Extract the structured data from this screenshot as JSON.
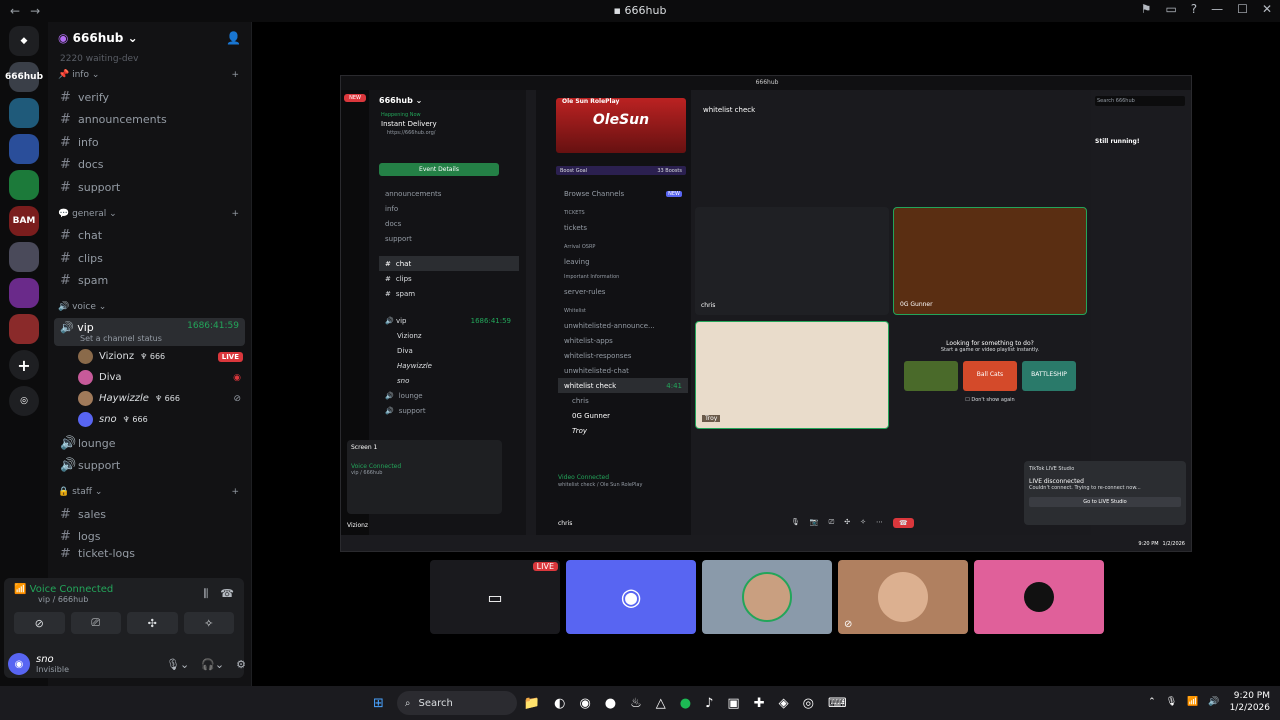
{
  "window": {
    "title": "666hub"
  },
  "rail": {
    "servers": [
      "666hub",
      "BAM",
      "Ole Sun"
    ]
  },
  "server": {
    "name": "666hub"
  },
  "sidebar": {
    "truncated": "2220 waiting-dev",
    "categories": [
      {
        "name": "info",
        "channels": [
          "verify",
          "announcements",
          "info",
          "docs",
          "support"
        ]
      },
      {
        "name": "general",
        "channels": [
          "chat",
          "clips",
          "spam"
        ]
      },
      {
        "name": "voice"
      }
    ],
    "vip": {
      "name": "vip",
      "timer": "1686:41:59",
      "status": "Set a channel status"
    },
    "voice_users": [
      {
        "name": "Vizionz",
        "tag": "666",
        "live": "LIVE"
      },
      {
        "name": "Diva"
      },
      {
        "name": "Haywizzle",
        "tag": "666"
      },
      {
        "name": "sno",
        "tag": "666"
      }
    ],
    "voice_channels": [
      "lounge",
      "support"
    ],
    "staff": {
      "name": "staff",
      "channels": [
        "sales",
        "logs",
        "ticket-logs"
      ]
    }
  },
  "voice_panel": {
    "title": "Voice Connected",
    "sub": "vip / 666hub"
  },
  "user": {
    "name": "sno",
    "status": "Invisible"
  },
  "stream": {
    "inner_title": "Ole Sun RolePlay",
    "hub_name": "666hub",
    "event": {
      "tag": "Happening Now",
      "name": "Instant Delivery",
      "url": "https://666hub.org/",
      "button": "Event Details"
    },
    "inner_channels": [
      "announcements",
      "info",
      "docs",
      "support"
    ],
    "chat": "chat",
    "clips": "clips",
    "spam": "spam",
    "vip": "vip",
    "vip_timer": "1686:41:59",
    "lounge": "lounge",
    "support2": "support",
    "inner_users": [
      "Vizionz",
      "Diva",
      "Haywizzle",
      "sno"
    ],
    "screen": "Screen 1",
    "inner_vc": "Voice Connected",
    "inner_vc_sub": "vip / 666hub",
    "inner_user": "Vizionz",
    "ole_sun": "Ole Sun RolePlay",
    "boost": "Boost Goal",
    "boost_count": "33 Boosts",
    "browse": "Browse Channels",
    "browse_badge": "NEW",
    "tickets_cat": "TICKETS",
    "tickets": "tickets",
    "arrival": "Arrival OSRP",
    "leaving": "leaving",
    "important": "Important Information",
    "rules": "server-rules",
    "whitelist_cat": "Whitelist",
    "wl_channels": [
      "unwhitelisted-announce...",
      "whitelist-apps",
      "whitelist-responses",
      "unwhitelisted-chat"
    ],
    "wl_check": "whitelist check",
    "wl_timer": "4:41",
    "wl_users": [
      "chris",
      "0G Gunner",
      "Troy"
    ],
    "video_vc": "Video Connected",
    "video_vc_sub": "whitelist check / Ole Sun RolePlay",
    "chris": "chris",
    "header": "whitelist check",
    "tiles": [
      "chris",
      "0G Gunner",
      "Troy"
    ],
    "activity": {
      "title": "Looking for something to do?",
      "sub": "Start a game or video playlist instantly.",
      "dont": "Don't show again",
      "games": [
        "Ball Cats",
        "BATTLESHIP"
      ]
    },
    "tiktok": {
      "app": "TikTok LIVE Studio",
      "title": "LIVE disconnected",
      "msg": "Couldn't connect. Trying to re-connect now...",
      "btn": "Go to LIVE Studio"
    },
    "right_search": "Search 666hub",
    "right_text": "Still running!",
    "inner_time": "9:20 PM",
    "inner_date": "1/2/2026"
  },
  "thumbs": {
    "live": "LIVE"
  },
  "taskbar": {
    "search": "Search",
    "time": "9:20 PM",
    "date": "1/2/2026"
  }
}
